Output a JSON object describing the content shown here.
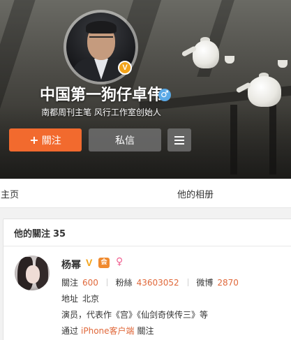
{
  "profile": {
    "name": "中国第一狗仔卓伟",
    "bio": "南都周刊主笔 风行工作室创始人",
    "verified_badge": "V",
    "gender_symbol": "♂"
  },
  "actions": {
    "follow_label": "關注",
    "message_label": "私信"
  },
  "tabs": {
    "home": "的主页",
    "album": "他的相册"
  },
  "following": {
    "title": "他的關注",
    "count": "35",
    "user": {
      "name": "杨幂",
      "verified_badge": "V",
      "female_symbol": "♀",
      "club_badge": "会",
      "follow_label": "關注",
      "follow_count": "600",
      "fans_label": "粉絲",
      "fans_count": "43603052",
      "weibo_label": "微博",
      "weibo_count": "2870",
      "address_label": "地址",
      "address": "北京",
      "intro": "演员，代表作《宫》《仙剑奇侠传三》等",
      "via_prefix": "通过",
      "via_client": "iPhone客户端",
      "via_suffix": "關注"
    }
  },
  "colors": {
    "accent_orange": "#f26a2e",
    "link_orange": "#e0683a",
    "vip_gold": "#f3a31a",
    "gender_blue": "#5aa9e6"
  },
  "icons": {
    "verified": "verified-v-icon",
    "gender": "male-icon",
    "female": "female-icon",
    "club": "club-badge-icon",
    "more": "menu-icon",
    "plus": "plus-icon"
  }
}
